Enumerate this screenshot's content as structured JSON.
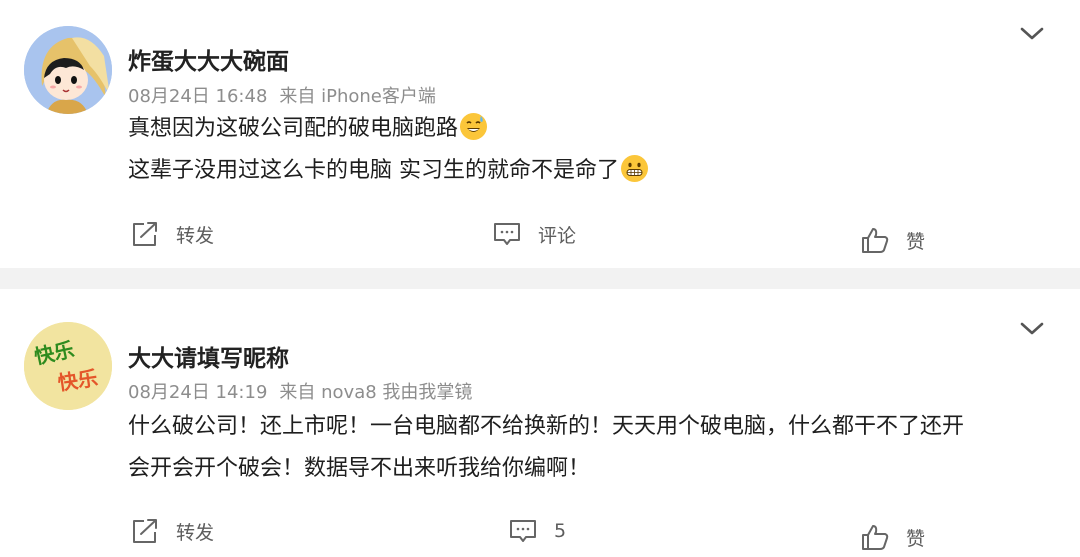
{
  "posts": [
    {
      "username": "炸蛋大大大碗面",
      "time": "08月24日 16:48",
      "source": "来自 iPhone客户端",
      "lines": [
        "真想因为这破公司配的破电脑跑路",
        "这辈子没用过这么卡的电脑 实习生的就命不是命了"
      ],
      "line_emojis": [
        "sweat-smile-emoji",
        "grimace-emoji"
      ],
      "share_label": "转发",
      "comment_label": "评论",
      "like_label": "赞"
    },
    {
      "username": "大大请填写昵称",
      "time": "08月24日 14:19",
      "source": "来自 nova8 我由我掌镜",
      "lines": [
        "什么破公司！还上市呢！一台电脑都不给换新的！天天用个破电脑，什么都干不了还开",
        "会开会开个破会！数据导不出来听我给你编啊！"
      ],
      "avatar_text": [
        "快乐",
        "快乐"
      ],
      "share_label": "转发",
      "comment_label": "5",
      "like_label": "赞"
    }
  ],
  "colors": {
    "background": "#f2f2f2",
    "card": "#ffffff",
    "meta_text": "#8d8d8d",
    "action_text": "#5d5d5d"
  },
  "icons": [
    "chevron-down-icon",
    "share-icon",
    "comment-icon",
    "like-icon"
  ]
}
